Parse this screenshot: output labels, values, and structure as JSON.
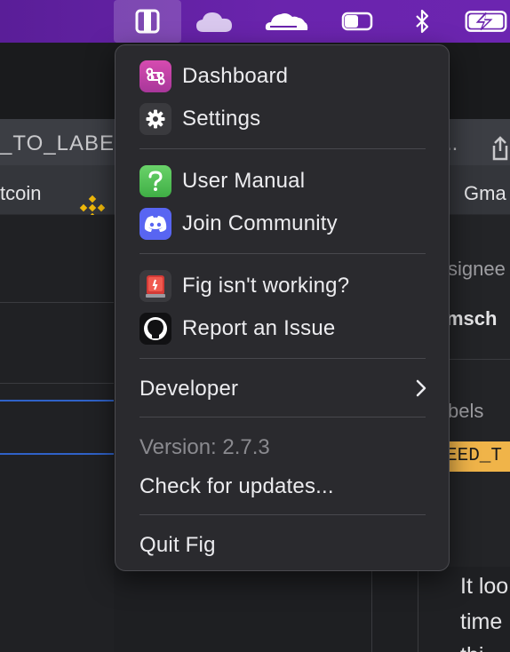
{
  "menubar": {
    "icons": [
      "fig-panel-icon",
      "onedrive-cloud-icon",
      "cloudflare-icon",
      "toggle-icon",
      "bluetooth-icon",
      "battery-charging-icon"
    ],
    "accent": "#6a24ad"
  },
  "background": {
    "url_left": "_TO_LABE",
    "url_right": "..",
    "tab_left": "tcoin",
    "tab_right": "Gma",
    "assignee_label": "signee",
    "assignee_name": "msch",
    "labels_label": "bels",
    "label_tag": "EED_T",
    "comment_line1": "It loo",
    "comment_line2": "time",
    "comment_line3": "thi"
  },
  "menu": {
    "items": [
      {
        "label": "Dashboard",
        "icon": "command-icon",
        "color": "#c743a6"
      },
      {
        "label": "Settings",
        "icon": "gear-icon"
      },
      {
        "label": "User Manual",
        "icon": "question-icon",
        "color": "#4fbf52"
      },
      {
        "label": "Join Community",
        "icon": "discord-icon",
        "color": "#5865f2"
      },
      {
        "label": "Fig isn't working?",
        "icon": "siren-icon"
      },
      {
        "label": "Report an Issue",
        "icon": "github-icon"
      }
    ],
    "developer_label": "Developer",
    "version_text": "Version: 2.7.3",
    "check_updates_label": "Check for updates...",
    "quit_label": "Quit Fig"
  }
}
